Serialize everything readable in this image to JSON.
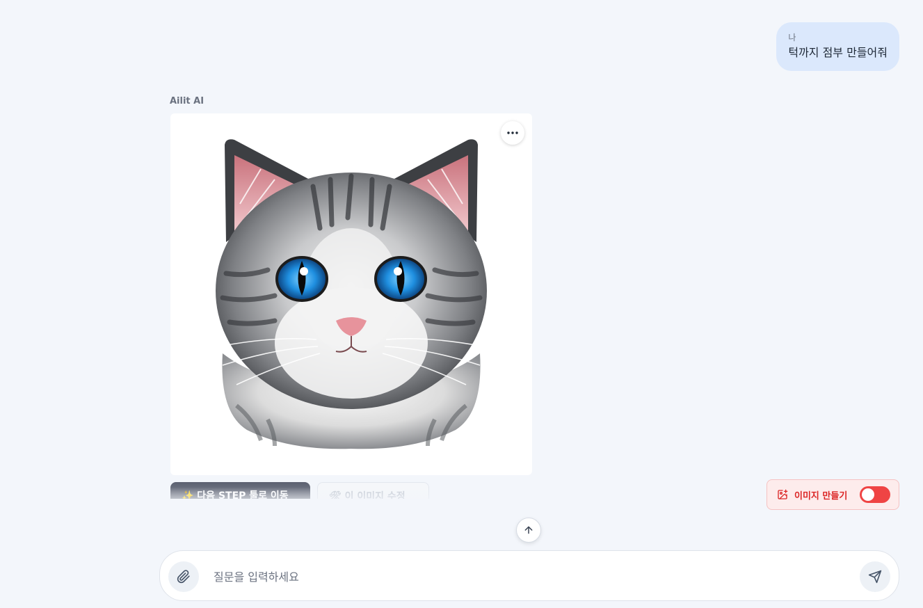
{
  "conversation": {
    "user_message": {
      "sender": "나",
      "text": "턱까지 점부 만들어줘"
    },
    "ai_message": {
      "sender": "Ailit AI",
      "image_subject": "silver tabby kitten portrait",
      "actions": [
        {
          "label": "✨ 다음 STEP 툴로 이동"
        },
        {
          "label": "🛠 이 이미지 수정"
        }
      ]
    }
  },
  "image_mode_toggle": {
    "label": "이미지 만들기",
    "on": false,
    "accent_color": "#ef4444"
  },
  "composer": {
    "placeholder": "질문을 입력하세요",
    "value": ""
  },
  "icons": {
    "more": "more-horizontal-icon",
    "scroll_top": "arrow-up-icon",
    "attach": "paperclip-icon",
    "send": "send-icon",
    "image_mode": "image-plus-icon"
  }
}
